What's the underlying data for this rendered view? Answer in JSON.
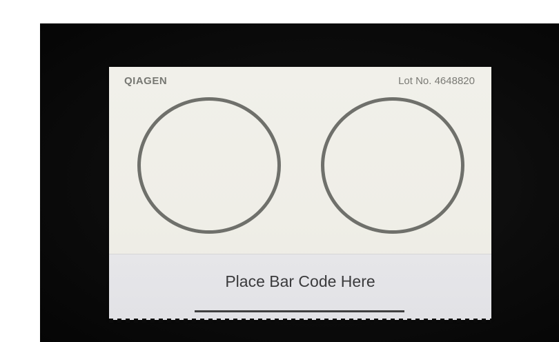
{
  "card": {
    "brand": "QIAGEN",
    "lot_label": "Lot No. 4648820"
  },
  "strip": {
    "label": "Place Bar Code Here"
  },
  "colors": {
    "card": "#efeee7",
    "strip": "#e3e3e6",
    "circle_stroke": "#6f706b",
    "text": "#3a3a3c",
    "background": "#0c0c0c"
  }
}
